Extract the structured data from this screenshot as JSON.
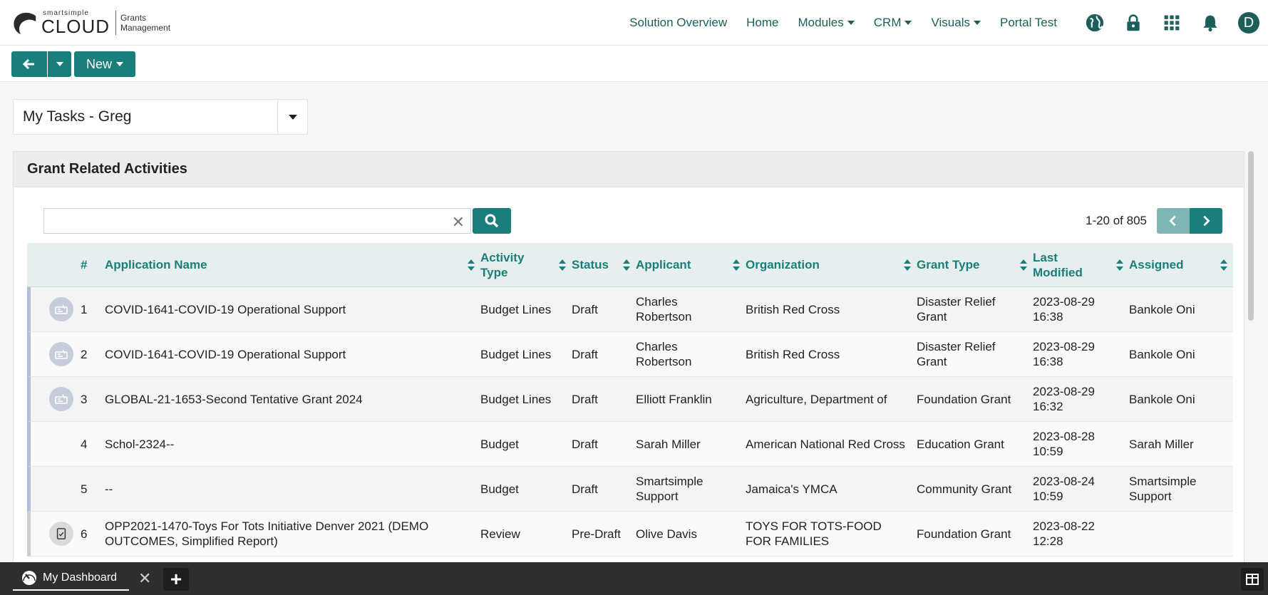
{
  "header": {
    "logo_small": "smartsimple",
    "logo_big": "CLOUD",
    "product_line1": "Grants",
    "product_line2": "Management",
    "nav": [
      {
        "label": "Solution Overview",
        "dropdown": false
      },
      {
        "label": "Home",
        "dropdown": false
      },
      {
        "label": "Modules",
        "dropdown": true
      },
      {
        "label": "CRM",
        "dropdown": true
      },
      {
        "label": "Visuals",
        "dropdown": true
      },
      {
        "label": "Portal Test",
        "dropdown": false
      }
    ],
    "icons": [
      "globe-icon",
      "lock-icon",
      "apps-grid-icon",
      "bell-icon"
    ],
    "avatar_initial": "D"
  },
  "toolbar": {
    "new_label": "New"
  },
  "view": {
    "selected": "My Tasks - Greg"
  },
  "panel": {
    "title": "Grant Related Activities",
    "search_placeholder": "",
    "search_value": "",
    "paging_text": "1-20 of 805"
  },
  "table": {
    "columns": [
      {
        "label": "#"
      },
      {
        "label": "Application Name"
      },
      {
        "label": "Activity Type"
      },
      {
        "label": "Status"
      },
      {
        "label": "Applicant"
      },
      {
        "label": "Organization"
      },
      {
        "label": "Grant Type"
      },
      {
        "label": "Last Modified"
      },
      {
        "label": "Assigned"
      }
    ],
    "rows": [
      {
        "icon": "budget-icon",
        "num": "1",
        "app": "COVID-1641-COVID-19 Operational Support",
        "activity": "Budget Lines",
        "status": "Draft",
        "applicant": "Charles Robertson",
        "org": "British Red Cross",
        "grant": "Disaster Relief Grant",
        "modified": "2023-08-29 16:38",
        "assigned": "Bankole Oni"
      },
      {
        "icon": "budget-icon",
        "num": "2",
        "app": "COVID-1641-COVID-19 Operational Support",
        "activity": "Budget Lines",
        "status": "Draft",
        "applicant": "Charles Robertson",
        "org": "British Red Cross",
        "grant": "Disaster Relief Grant",
        "modified": "2023-08-29 16:38",
        "assigned": "Bankole Oni"
      },
      {
        "icon": "budget-icon",
        "num": "3",
        "app": "GLOBAL-21-1653-Second Tentative Grant 2024",
        "activity": "Budget Lines",
        "status": "Draft",
        "applicant": "Elliott Franklin",
        "org": "Agriculture, Department of",
        "grant": "Foundation Grant",
        "modified": "2023-08-29 16:32",
        "assigned": "Bankole Oni"
      },
      {
        "icon": "",
        "num": "4",
        "app": "Schol-2324--",
        "activity": "Budget",
        "status": "Draft",
        "applicant": "Sarah Miller",
        "org": "American National Red Cross",
        "grant": "Education Grant",
        "modified": "2023-08-28 10:59",
        "assigned": "Sarah Miller"
      },
      {
        "icon": "",
        "num": "5",
        "app": "--",
        "activity": "Budget",
        "status": "Draft",
        "applicant": "Smartsimple Support",
        "org": "Jamaica's YMCA",
        "grant": "Community Grant",
        "modified": "2023-08-24 10:59",
        "assigned": "Smartsimple Support"
      },
      {
        "icon": "review-icon",
        "num": "6",
        "app": "OPP2021-1470-Toys For Tots Initiative Denver 2021 (DEMO OUTCOMES, Simplified Report)",
        "activity": "Review",
        "status": "Pre-Draft",
        "applicant": "Olive Davis",
        "org": "TOYS FOR TOTS-FOOD FOR FAMILIES",
        "grant": "Foundation Grant",
        "modified": "2023-08-22 12:28",
        "assigned": ""
      }
    ]
  },
  "bottombar": {
    "tab_label": "My Dashboard"
  },
  "colors": {
    "accent": "#1a7f7a",
    "nav_text": "#1c5f5a",
    "row_marker": "#b5bdd6"
  }
}
